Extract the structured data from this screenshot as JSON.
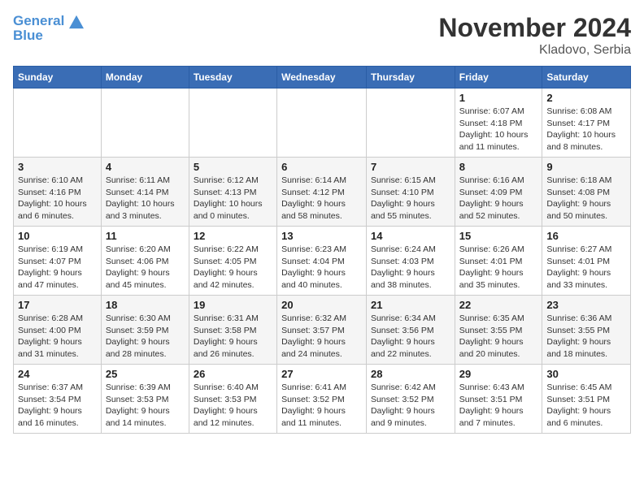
{
  "header": {
    "logo_line1": "General",
    "logo_line2": "Blue",
    "month": "November 2024",
    "location": "Kladovo, Serbia"
  },
  "weekdays": [
    "Sunday",
    "Monday",
    "Tuesday",
    "Wednesday",
    "Thursday",
    "Friday",
    "Saturday"
  ],
  "weeks": [
    [
      {
        "day": "",
        "info": ""
      },
      {
        "day": "",
        "info": ""
      },
      {
        "day": "",
        "info": ""
      },
      {
        "day": "",
        "info": ""
      },
      {
        "day": "",
        "info": ""
      },
      {
        "day": "1",
        "info": "Sunrise: 6:07 AM\nSunset: 4:18 PM\nDaylight: 10 hours and 11 minutes."
      },
      {
        "day": "2",
        "info": "Sunrise: 6:08 AM\nSunset: 4:17 PM\nDaylight: 10 hours and 8 minutes."
      }
    ],
    [
      {
        "day": "3",
        "info": "Sunrise: 6:10 AM\nSunset: 4:16 PM\nDaylight: 10 hours and 6 minutes."
      },
      {
        "day": "4",
        "info": "Sunrise: 6:11 AM\nSunset: 4:14 PM\nDaylight: 10 hours and 3 minutes."
      },
      {
        "day": "5",
        "info": "Sunrise: 6:12 AM\nSunset: 4:13 PM\nDaylight: 10 hours and 0 minutes."
      },
      {
        "day": "6",
        "info": "Sunrise: 6:14 AM\nSunset: 4:12 PM\nDaylight: 9 hours and 58 minutes."
      },
      {
        "day": "7",
        "info": "Sunrise: 6:15 AM\nSunset: 4:10 PM\nDaylight: 9 hours and 55 minutes."
      },
      {
        "day": "8",
        "info": "Sunrise: 6:16 AM\nSunset: 4:09 PM\nDaylight: 9 hours and 52 minutes."
      },
      {
        "day": "9",
        "info": "Sunrise: 6:18 AM\nSunset: 4:08 PM\nDaylight: 9 hours and 50 minutes."
      }
    ],
    [
      {
        "day": "10",
        "info": "Sunrise: 6:19 AM\nSunset: 4:07 PM\nDaylight: 9 hours and 47 minutes."
      },
      {
        "day": "11",
        "info": "Sunrise: 6:20 AM\nSunset: 4:06 PM\nDaylight: 9 hours and 45 minutes."
      },
      {
        "day": "12",
        "info": "Sunrise: 6:22 AM\nSunset: 4:05 PM\nDaylight: 9 hours and 42 minutes."
      },
      {
        "day": "13",
        "info": "Sunrise: 6:23 AM\nSunset: 4:04 PM\nDaylight: 9 hours and 40 minutes."
      },
      {
        "day": "14",
        "info": "Sunrise: 6:24 AM\nSunset: 4:03 PM\nDaylight: 9 hours and 38 minutes."
      },
      {
        "day": "15",
        "info": "Sunrise: 6:26 AM\nSunset: 4:01 PM\nDaylight: 9 hours and 35 minutes."
      },
      {
        "day": "16",
        "info": "Sunrise: 6:27 AM\nSunset: 4:01 PM\nDaylight: 9 hours and 33 minutes."
      }
    ],
    [
      {
        "day": "17",
        "info": "Sunrise: 6:28 AM\nSunset: 4:00 PM\nDaylight: 9 hours and 31 minutes."
      },
      {
        "day": "18",
        "info": "Sunrise: 6:30 AM\nSunset: 3:59 PM\nDaylight: 9 hours and 28 minutes."
      },
      {
        "day": "19",
        "info": "Sunrise: 6:31 AM\nSunset: 3:58 PM\nDaylight: 9 hours and 26 minutes."
      },
      {
        "day": "20",
        "info": "Sunrise: 6:32 AM\nSunset: 3:57 PM\nDaylight: 9 hours and 24 minutes."
      },
      {
        "day": "21",
        "info": "Sunrise: 6:34 AM\nSunset: 3:56 PM\nDaylight: 9 hours and 22 minutes."
      },
      {
        "day": "22",
        "info": "Sunrise: 6:35 AM\nSunset: 3:55 PM\nDaylight: 9 hours and 20 minutes."
      },
      {
        "day": "23",
        "info": "Sunrise: 6:36 AM\nSunset: 3:55 PM\nDaylight: 9 hours and 18 minutes."
      }
    ],
    [
      {
        "day": "24",
        "info": "Sunrise: 6:37 AM\nSunset: 3:54 PM\nDaylight: 9 hours and 16 minutes."
      },
      {
        "day": "25",
        "info": "Sunrise: 6:39 AM\nSunset: 3:53 PM\nDaylight: 9 hours and 14 minutes."
      },
      {
        "day": "26",
        "info": "Sunrise: 6:40 AM\nSunset: 3:53 PM\nDaylight: 9 hours and 12 minutes."
      },
      {
        "day": "27",
        "info": "Sunrise: 6:41 AM\nSunset: 3:52 PM\nDaylight: 9 hours and 11 minutes."
      },
      {
        "day": "28",
        "info": "Sunrise: 6:42 AM\nSunset: 3:52 PM\nDaylight: 9 hours and 9 minutes."
      },
      {
        "day": "29",
        "info": "Sunrise: 6:43 AM\nSunset: 3:51 PM\nDaylight: 9 hours and 7 minutes."
      },
      {
        "day": "30",
        "info": "Sunrise: 6:45 AM\nSunset: 3:51 PM\nDaylight: 9 hours and 6 minutes."
      }
    ]
  ]
}
